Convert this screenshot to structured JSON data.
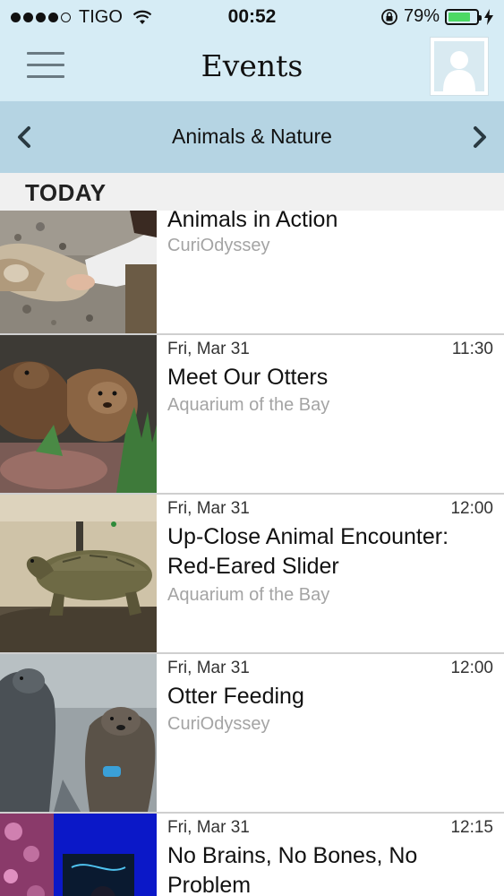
{
  "status_bar": {
    "carrier": "TIGO",
    "time": "00:52",
    "battery_percent": "79%",
    "battery_level": 0.79,
    "signal_dots": 4,
    "battery_color": "#4cd964"
  },
  "header": {
    "title": "Events",
    "menu_icon": "hamburger-menu-icon",
    "profile_icon": "user-avatar-icon",
    "background": "#d6ecf5"
  },
  "category_bar": {
    "label": "Animals & Nature",
    "prev_icon": "chevron-left-icon",
    "next_icon": "chevron-right-icon",
    "background": "#b5d4e3"
  },
  "section": {
    "label": "TODAY"
  },
  "events": [
    {
      "date": "",
      "time": "",
      "title": "Animals in Action",
      "venue": "CuriOdyssey",
      "image": "wolf-and-handler"
    },
    {
      "date": "Fri, Mar 31",
      "time": "11:30",
      "title": "Meet Our Otters",
      "venue": "Aquarium of the Bay",
      "image": "otters"
    },
    {
      "date": "Fri, Mar 31",
      "time": "12:00",
      "title": "Up-Close Animal Encounter: Red-Eared Slider",
      "venue": "Aquarium of the Bay",
      "image": "turtle"
    },
    {
      "date": "Fri, Mar 31",
      "time": "12:00",
      "title": "Otter Feeding",
      "venue": "CuriOdyssey",
      "image": "standing-otters"
    },
    {
      "date": "Fri, Mar 31",
      "time": "12:15",
      "title": "No Brains, No Bones, No Problem",
      "venue": "",
      "image": "jellyfish-exhibit"
    }
  ]
}
